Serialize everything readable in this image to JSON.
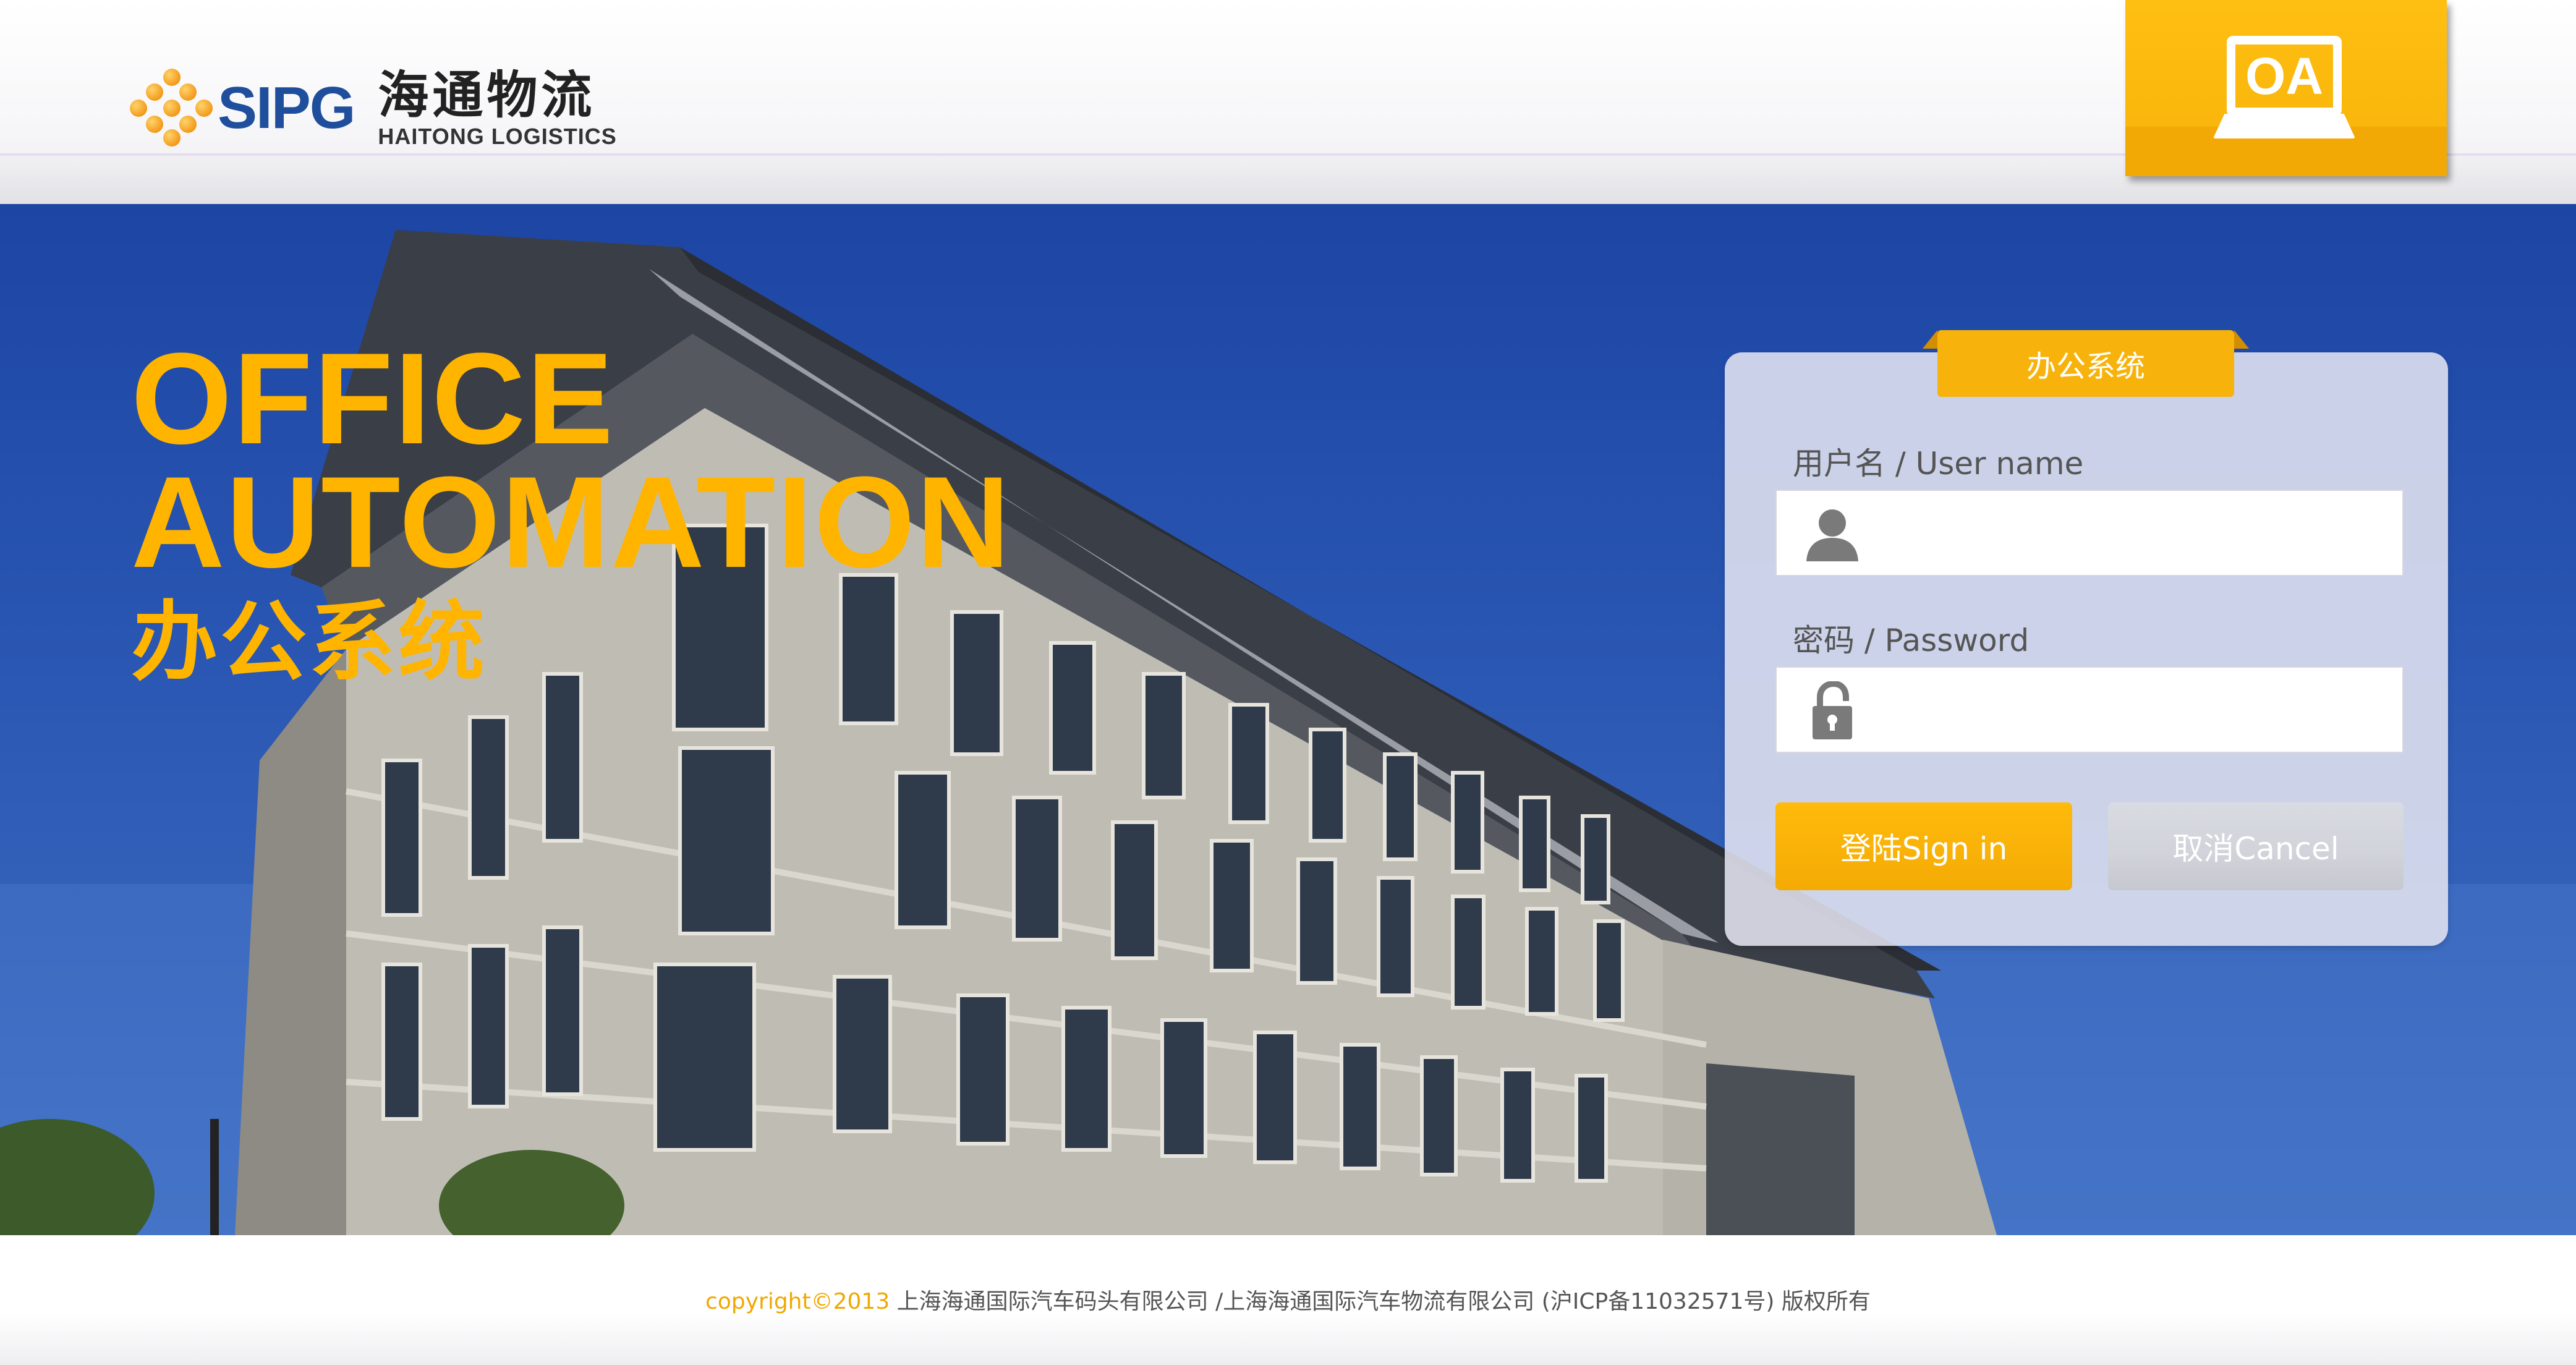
{
  "header": {
    "logo": {
      "brand": "SIPG",
      "name_cn": "海通物流",
      "name_en": "HAITONG LOGISTICS"
    },
    "oa_badge": {
      "label": "OA",
      "icon": "computer-monitor-icon",
      "color": "#ffb400"
    }
  },
  "hero": {
    "title_line1": "OFFICE",
    "title_line2": "AUTOMATION",
    "subtitle": "办公系统",
    "accent_color": "#ffb400"
  },
  "login": {
    "tab_label": "办公系统",
    "username": {
      "label": "用户名 / User name",
      "value": "",
      "icon": "user-icon"
    },
    "password": {
      "label": "密码 / Password",
      "value": "",
      "icon": "lock-icon"
    },
    "signin_label": "登陆Sign in",
    "cancel_label": "取消Cancel"
  },
  "footer": {
    "copyright": "copyright©2013",
    "text": " 上海海通国际汽车码头有限公司 /上海海通国际汽车物流有限公司 (沪ICP备11032571号) 版权所有"
  }
}
